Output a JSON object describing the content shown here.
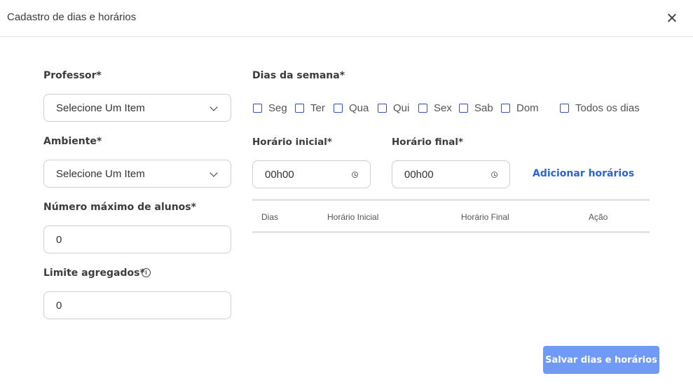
{
  "modal": {
    "title": "Cadastro de dias e horários"
  },
  "form": {
    "professor": {
      "label": "Professor*",
      "value": "Selecione Um Item"
    },
    "ambiente": {
      "label": "Ambiente*",
      "value": "Selecione Um Item"
    },
    "max_alunos": {
      "label": "Número máximo de alunos*",
      "value": "0"
    },
    "limite_agregados": {
      "label": "Limite agregados*",
      "value": "0"
    }
  },
  "dias_semana": {
    "label": "Dias da semana*",
    "options": [
      "Seg",
      "Ter",
      "Qua",
      "Qui",
      "Sex",
      "Sab",
      "Dom"
    ],
    "all_label": "Todos os dias"
  },
  "horarios": {
    "inicial": {
      "label": "Horário inicial*",
      "value": "00h00"
    },
    "final": {
      "label": "Horário final*",
      "value": "00h00"
    },
    "add_label": "Adicionar horários"
  },
  "table": {
    "columns": [
      "Dias",
      "Horário Inicial",
      "Horário Final",
      "Ação"
    ]
  },
  "footer": {
    "save_label": "Salvar dias e horários"
  },
  "colors": {
    "accent": "#2b63d9",
    "checkbox": "#2f4fb9",
    "button_bg": "#6f9af5"
  }
}
